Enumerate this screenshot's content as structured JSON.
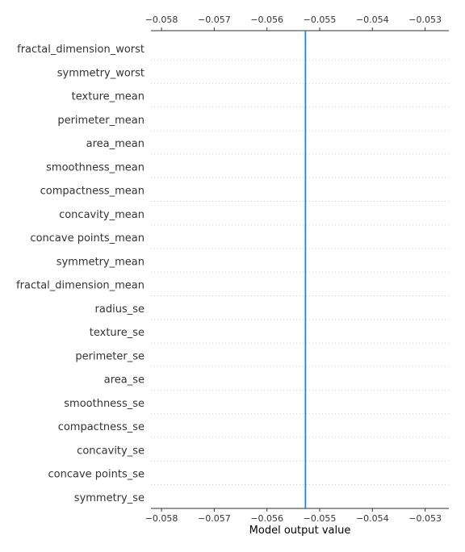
{
  "chart_data": {
    "type": "line",
    "title": "",
    "xlabel": "Model output value",
    "ylabel": "",
    "xlim": [
      -0.0582,
      -0.05255
    ],
    "x_ticks": [
      -0.058,
      -0.057,
      -0.056,
      -0.055,
      -0.054,
      -0.053
    ],
    "x_tick_labels": [
      "−0.058",
      "−0.057",
      "−0.056",
      "−0.055",
      "−0.054",
      "−0.053"
    ],
    "features": [
      "fractal_dimension_worst",
      "symmetry_worst",
      "texture_mean",
      "perimeter_mean",
      "area_mean",
      "smoothness_mean",
      "compactness_mean",
      "concavity_mean",
      "concave points_mean",
      "symmetry_mean",
      "fractal_dimension_mean",
      "radius_se",
      "texture_se",
      "perimeter_se",
      "area_se",
      "smoothness_se",
      "compactness_se",
      "concavity_se",
      "concave points_se",
      "symmetry_se"
    ],
    "base_value": -0.05527,
    "series": [
      {
        "color": "#1e88e5",
        "values": [
          -0.05527,
          -0.05527,
          -0.05527,
          -0.05527,
          -0.05527,
          -0.05527,
          -0.05527,
          -0.05527,
          -0.05527,
          -0.05527,
          -0.05527,
          -0.05527,
          -0.05527,
          -0.05527,
          -0.05527,
          -0.05527,
          -0.05527,
          -0.05527,
          -0.05527,
          -0.05527
        ]
      }
    ],
    "grid": "dotted horizontal",
    "axis_color": "#333333",
    "grid_color": "#cccccc",
    "base_line_color": "#999999"
  }
}
